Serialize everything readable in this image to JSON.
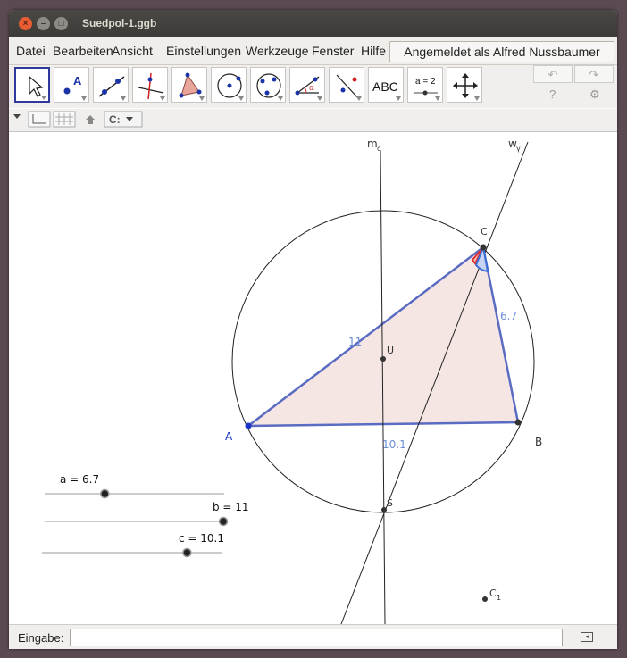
{
  "window": {
    "title": "Suedpol-1.ggb"
  },
  "titlebar_buttons": {
    "close": "×",
    "minimize": "–",
    "maximize": "□"
  },
  "menu": [
    "Datei",
    "Bearbeiten",
    "Ansicht",
    "Einstellungen",
    "Werkzeuge",
    "Fenster",
    "Hilfe"
  ],
  "login": "Angemeldet als Alfred Nussbaumer",
  "toolbar": {
    "tools": [
      "move",
      "point",
      "line",
      "perpendicular",
      "polygon",
      "circle-center",
      "circle-three-points",
      "angle",
      "reflect",
      "text",
      "slider",
      "move-view"
    ],
    "text_tool_label": "ABC",
    "slider_tool_label": "a = 2",
    "undo": "↶",
    "redo": "↷",
    "help": "?",
    "settings": "⚙"
  },
  "canvas": {
    "point_labels": {
      "A": "A",
      "B": "B",
      "C": "C",
      "U": "U",
      "S": "S",
      "C1": "C",
      "C1_sub": "1"
    },
    "line_labels": {
      "m": "m",
      "m_sub": "c",
      "w": "w",
      "w_sub": "γ"
    },
    "segment_labels": {
      "b": "11",
      "a": "6.7",
      "c": "10.1"
    },
    "sliders": [
      {
        "label": "a = 6.7",
        "value": 6.7,
        "min": 0,
        "max": 20
      },
      {
        "label": "b = 11",
        "value": 11,
        "min": 0,
        "max": 11
      },
      {
        "label": "c = 10.1",
        "value": 10.1,
        "min": 0,
        "max": 12.5
      }
    ],
    "colors": {
      "triangle_fill": "#f5e6e4",
      "triangle_edge": "#5a6bc2",
      "label_blue": "#6d8fd6",
      "point_A": "#1a33c8",
      "angle_red": "#e0302f",
      "angle_blue": "#3a6fd8"
    }
  },
  "input": {
    "label": "Eingabe:",
    "value": ""
  }
}
